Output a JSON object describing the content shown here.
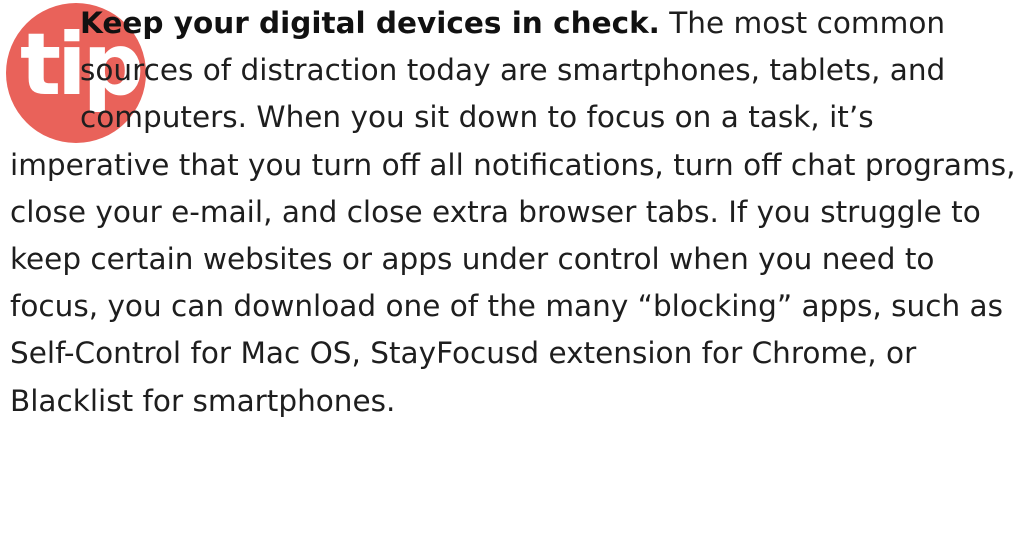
{
  "tip": {
    "badge_label": "tip",
    "badge_color": "#e9625a",
    "lead": "Keep your digital devices in check.",
    "body": "The most common sources of distraction today are smartphones, tablets, and computers. When you sit down to focus on a task, it’s imperative that you turn off all notifications, turn off chat programs, close your e-mail, and close extra browser tabs. If you struggle to keep certain websites or apps under control when you need to focus, you can download one of the many “blocking” apps, such as Self-Control for Mac OS, StayFocusd extension for Chrome, or Blacklist for smartphones."
  }
}
